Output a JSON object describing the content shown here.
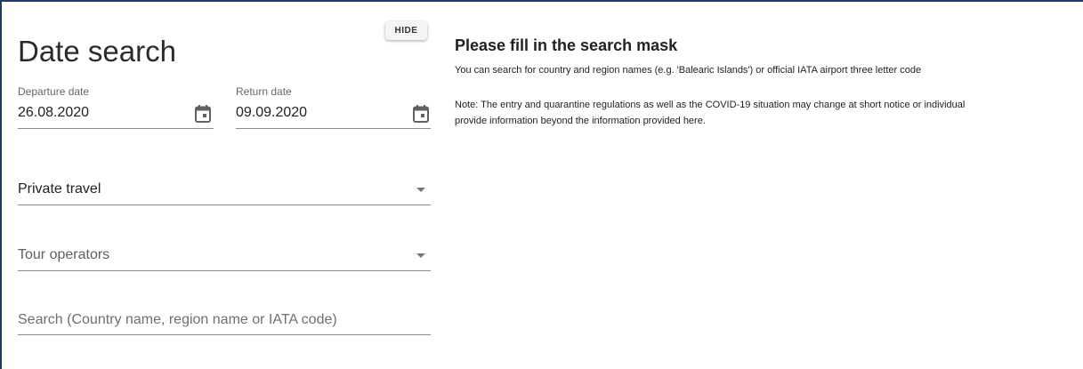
{
  "search_panel": {
    "hide_label": "HIDE",
    "title": "Date search",
    "departure": {
      "label": "Departure date",
      "value": "26.08.2020"
    },
    "return": {
      "label": "Return date",
      "value": "09.09.2020"
    },
    "travel_type": {
      "value": "Private travel"
    },
    "tour_operators": {
      "value": "Tour operators"
    },
    "search": {
      "placeholder": "Search (Country name, region name or IATA code)",
      "value": ""
    }
  },
  "info_panel": {
    "heading": "Please fill in the search mask",
    "hint": "You can search for country and region names (e.g. 'Balearic Islands') or official IATA airport three letter code",
    "note_line1": "Note: The entry and quarantine regulations as well as the COVID-19 situation may change at short notice or individual",
    "note_line2": "provide information beyond the information provided here."
  },
  "colors": {
    "frame_border": "#1f3a68",
    "underline": "#8a8a8a",
    "icon": "#616161"
  },
  "icons": {
    "calendar": "calendar-icon",
    "dropdown": "chevron-down-icon"
  }
}
